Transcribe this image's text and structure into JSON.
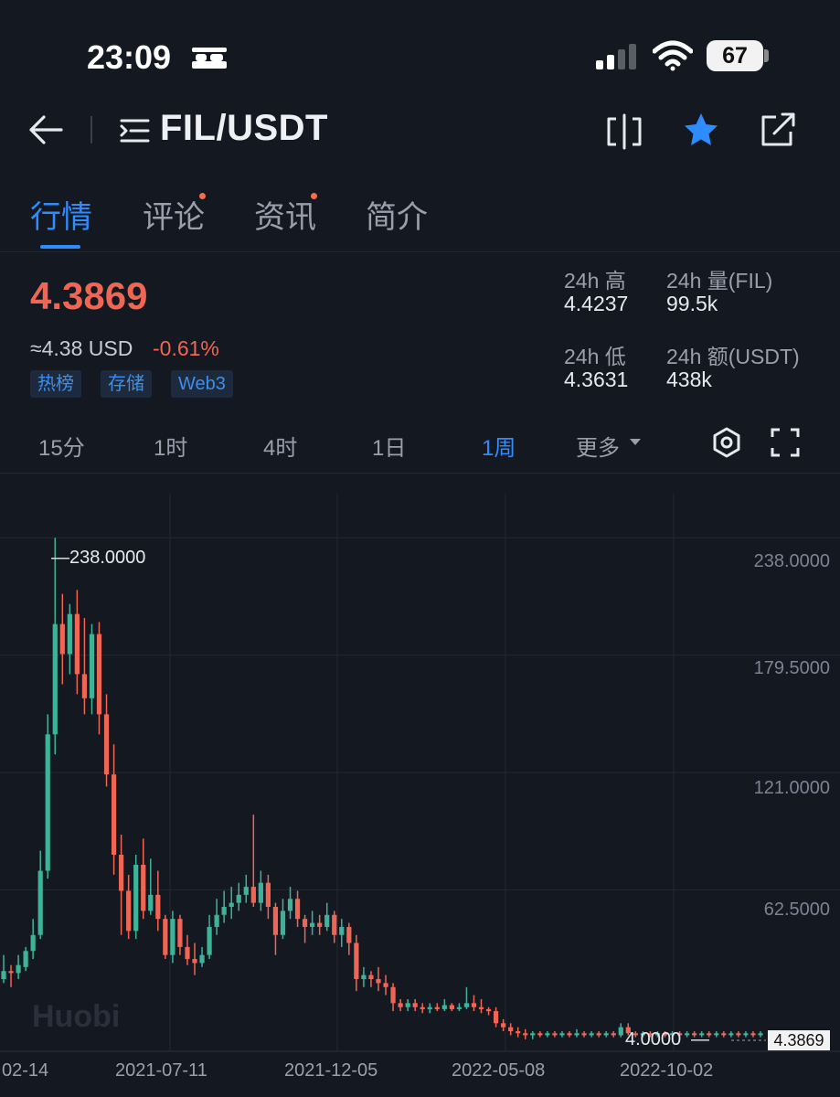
{
  "status": {
    "time": "23:09",
    "battery": "67"
  },
  "header": {
    "pair": "FIL/USDT"
  },
  "tabs": [
    {
      "label": "行情"
    },
    {
      "label": "评论"
    },
    {
      "label": "资讯"
    },
    {
      "label": "简介"
    }
  ],
  "price": {
    "last": "4.3869",
    "usd": "≈4.38 USD",
    "change": "-0.61%",
    "tags": [
      "热榜",
      "存储",
      "Web3"
    ]
  },
  "stats": {
    "high_label": "24h 高",
    "high_value": "4.4237",
    "low_label": "24h 低",
    "low_value": "4.3631",
    "vol_label": "24h 量(FIL)",
    "vol_value": "99.5k",
    "amt_label": "24h 额(USDT)",
    "amt_value": "438k"
  },
  "intervals": [
    "15分",
    "1时",
    "4时",
    "1日",
    "1周",
    "更多"
  ],
  "colors": {
    "up": "#3fb39a",
    "down": "#ef6655",
    "accent": "#2f8cff"
  },
  "chart_data": {
    "type": "candlestick",
    "y_ticks": [
      "238.0000",
      "179.5000",
      "121.0000",
      "62.5000"
    ],
    "ylim": [
      -18,
      260
    ],
    "x_ticks": [
      "02-14",
      "2021-07-11",
      "2021-12-05",
      "2022-05-08",
      "2022-10-02"
    ],
    "max_label": "238.0000",
    "min_label": "4.0000",
    "last_price": "4.3869",
    "watermark": "Huobi",
    "candles": [
      [
        18,
        22,
        30,
        16
      ],
      [
        22,
        21,
        25,
        14
      ],
      [
        21,
        25,
        30,
        18
      ],
      [
        24,
        32,
        34,
        22
      ],
      [
        32,
        40,
        48,
        28
      ],
      [
        40,
        72,
        82,
        38
      ],
      [
        72,
        140,
        150,
        68
      ],
      [
        140,
        195,
        238,
        130
      ],
      [
        195,
        180,
        210,
        165
      ],
      [
        180,
        200,
        205,
        170
      ],
      [
        200,
        170,
        212,
        160
      ],
      [
        170,
        158,
        198,
        150
      ],
      [
        158,
        190,
        195,
        150
      ],
      [
        190,
        150,
        196,
        140
      ],
      [
        150,
        120,
        160,
        114
      ],
      [
        120,
        80,
        135,
        70
      ],
      [
        80,
        62,
        90,
        40
      ],
      [
        62,
        42,
        70,
        38
      ],
      [
        42,
        75,
        80,
        38
      ],
      [
        75,
        52,
        88,
        48
      ],
      [
        52,
        60,
        78,
        50
      ],
      [
        60,
        48,
        72,
        42
      ],
      [
        48,
        30,
        50,
        28
      ],
      [
        30,
        48,
        52,
        26
      ],
      [
        48,
        34,
        50,
        30
      ],
      [
        34,
        28,
        40,
        25
      ],
      [
        28,
        26,
        36,
        20
      ],
      [
        26,
        30,
        34,
        24
      ],
      [
        30,
        44,
        50,
        28
      ],
      [
        44,
        50,
        58,
        40
      ],
      [
        50,
        54,
        62,
        46
      ],
      [
        54,
        56,
        64,
        48
      ],
      [
        56,
        60,
        66,
        52
      ],
      [
        60,
        64,
        70,
        56
      ],
      [
        64,
        56,
        100,
        54
      ],
      [
        56,
        66,
        72,
        52
      ],
      [
        66,
        54,
        70,
        48
      ],
      [
        54,
        40,
        56,
        30
      ],
      [
        40,
        52,
        58,
        38
      ],
      [
        52,
        58,
        64,
        48
      ],
      [
        58,
        48,
        62,
        44
      ],
      [
        48,
        44,
        50,
        36
      ],
      [
        44,
        46,
        52,
        40
      ],
      [
        46,
        44,
        50,
        40
      ],
      [
        44,
        50,
        56,
        42
      ],
      [
        50,
        40,
        52,
        36
      ],
      [
        40,
        44,
        48,
        34
      ],
      [
        44,
        36,
        46,
        30
      ],
      [
        36,
        18,
        40,
        12
      ],
      [
        18,
        20,
        24,
        14
      ],
      [
        20,
        18,
        22,
        14
      ],
      [
        18,
        16,
        24,
        12
      ],
      [
        16,
        14,
        20,
        10
      ],
      [
        14,
        6,
        16,
        2
      ],
      [
        6,
        4,
        8,
        2
      ],
      [
        4,
        6,
        8,
        2
      ],
      [
        6,
        4,
        8,
        2
      ],
      [
        4,
        3,
        6,
        1
      ],
      [
        3,
        4,
        6,
        1
      ],
      [
        4,
        3,
        6,
        2
      ],
      [
        3,
        5,
        8,
        2
      ],
      [
        5,
        3,
        6,
        2
      ],
      [
        3,
        4,
        6,
        2
      ],
      [
        4,
        6,
        14,
        3
      ],
      [
        6,
        4,
        10,
        2
      ],
      [
        4,
        3,
        8,
        1
      ],
      [
        3,
        2,
        4,
        0
      ],
      [
        2,
        -4,
        4,
        -6
      ],
      [
        -4,
        -6,
        -2,
        -8
      ],
      [
        -6,
        -8,
        -4,
        -10
      ],
      [
        -8,
        -9,
        -6,
        -11
      ],
      [
        -9,
        -10,
        -7,
        -12
      ],
      [
        -10,
        -9,
        -8,
        -12
      ],
      [
        -9,
        -10,
        -8,
        -11
      ],
      [
        -10,
        -9,
        -8,
        -11
      ],
      [
        -9,
        -10,
        -8,
        -11
      ],
      [
        -10,
        -9,
        -8,
        -11
      ],
      [
        -9,
        -10,
        -8,
        -11
      ],
      [
        -10,
        -9,
        -7,
        -11
      ],
      [
        -9,
        -10,
        -8,
        -11
      ],
      [
        -10,
        -9,
        -8,
        -11
      ],
      [
        -9,
        -10,
        -8,
        -11
      ],
      [
        -10,
        -9,
        -8,
        -11
      ],
      [
        -9,
        -10,
        -8,
        -11
      ],
      [
        -10,
        -6,
        -4,
        -11
      ],
      [
        -6,
        -9,
        -4,
        -10
      ],
      [
        -9,
        -10,
        -8,
        -11
      ],
      [
        -10,
        -9,
        -8,
        -11
      ],
      [
        -9,
        -10,
        -8,
        -11
      ],
      [
        -10,
        -9,
        -8,
        -11
      ],
      [
        -9,
        -10,
        -8,
        -11
      ],
      [
        -10,
        -9,
        -8,
        -11
      ],
      [
        -9,
        -10,
        -8,
        -11
      ],
      [
        -10,
        -9,
        -8,
        -11
      ],
      [
        -9,
        -10,
        -8,
        -11
      ],
      [
        -10,
        -9,
        -8,
        -11
      ],
      [
        -9,
        -10,
        -8,
        -11
      ],
      [
        -10,
        -9,
        -8,
        -11
      ],
      [
        -9,
        -10,
        -8,
        -11
      ],
      [
        -10,
        -9,
        -8,
        -11
      ],
      [
        -9,
        -10,
        -8,
        -11
      ],
      [
        -10,
        -9,
        -8,
        -11
      ],
      [
        -9,
        -10,
        -8,
        -11
      ],
      [
        -10,
        -9,
        -8,
        -11
      ]
    ]
  }
}
